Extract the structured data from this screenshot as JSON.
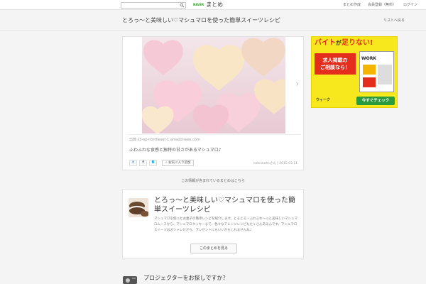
{
  "header": {
    "logo_small": "NAVER",
    "logo_main": "まとめ",
    "nav": [
      "まとめ作成",
      "会員登録（無料）",
      "ログイン"
    ]
  },
  "title_bar": {
    "title": "とろっ〜と美味しい♡マシュマロを使った簡単スイーツレシピ",
    "back_link": "リストへ戻る"
  },
  "main_item": {
    "source": "出典 s3-ap-northeast-1.amazonaws.com",
    "caption": "ふわふわな食感と独特の甘さがあるマシュマロ♪",
    "share_icons": [
      "twitter-icon",
      "facebook-icon",
      "hatena-icon"
    ],
    "favorite_label": "お気に入り追加",
    "author": "nohcinohcさん",
    "date": "2015.03.11"
  },
  "included_text": "この情報が含まれているまとめはこちら",
  "related": {
    "title": "とろっ〜と美味しい♡マシュマロを使った簡単スイーツレシピ",
    "description": "マシュマロを使ったお菓子の簡単レシピを紹介します。とろとろ・ふわふわ〜っと美味しいマシュマロムースから、マシュマロクッキーまで、色々なアレンジレシピもたくさんあるんです。マシュマロスイーツはオシャレだから、プレゼントにもいいかもしれませんね♪",
    "button": "このまとめを見る"
  },
  "bottom_teaser": "プロジェクターをお探しですか？",
  "ad": {
    "headline_a": "バイト",
    "headline_b": "が",
    "headline_c": "足りない!",
    "box": "求人掲載の\nご相談なら！",
    "magazine": "WORK",
    "brand": "ウィーク",
    "cta": "今すぐチェック"
  },
  "colors": {
    "page_bg": "#f4f4f4",
    "naver_green": "#3a9c2f",
    "ad_yellow": "#f7e81e",
    "ad_red": "#e52d1e",
    "ad_green": "#2a9c3e"
  }
}
